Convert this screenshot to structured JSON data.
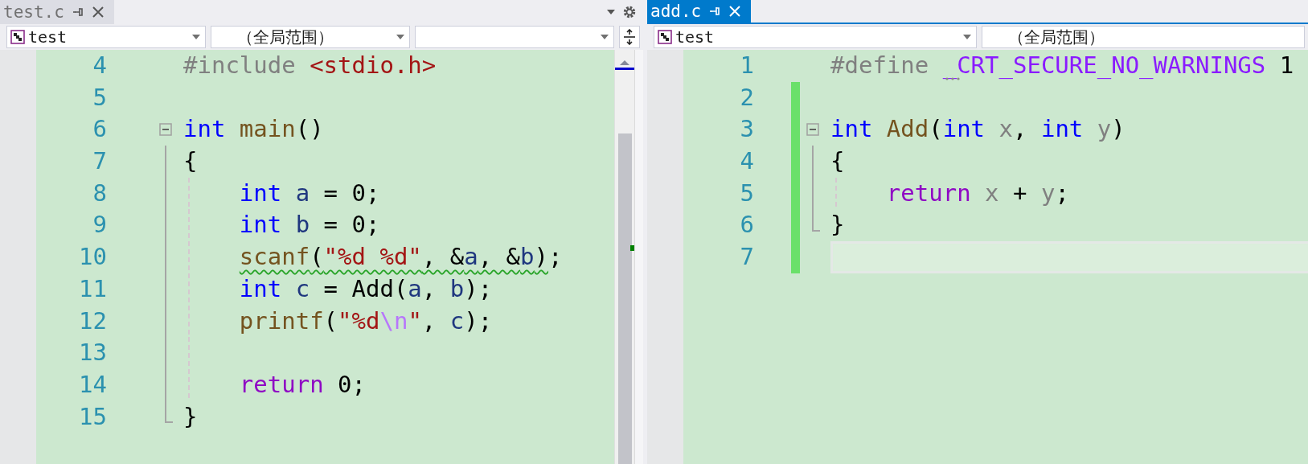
{
  "panes": [
    {
      "tab": {
        "label": "test.c",
        "selected": false
      },
      "tab_tools": true,
      "split_button": true,
      "scrollbar": true,
      "dropdowns": [
        {
          "kind": "project",
          "text": "test",
          "arrow": true
        },
        {
          "kind": "scope",
          "text": "（全局范围）",
          "arrow": true
        },
        {
          "kind": "member",
          "arrow": true
        }
      ],
      "lines": [
        {
          "number": "4",
          "tokens": [
            {
              "kind": "preprocessor",
              "text": "#include "
            },
            {
              "kind": "include",
              "text": "<stdio.h>"
            }
          ]
        },
        {
          "number": "5"
        },
        {
          "number": "6",
          "fold_start": true,
          "expanded": true,
          "tokens": [
            {
              "kind": "keyword",
              "text": "int "
            },
            {
              "kind": "func",
              "text": "main"
            },
            {
              "kind": "plain",
              "text": "()"
            }
          ]
        },
        {
          "number": "7",
          "in_fold": true,
          "tokens": [
            {
              "kind": "plain",
              "text": "{"
            }
          ]
        },
        {
          "number": "8",
          "in_fold": true,
          "indent_guide": true,
          "indented": true,
          "tokens": [
            {
              "kind": "keyword",
              "text": "int "
            },
            {
              "kind": "local",
              "text": "a"
            },
            {
              "kind": "plain",
              "text": " = 0;"
            }
          ]
        },
        {
          "number": "9",
          "in_fold": true,
          "indent_guide": true,
          "indented": true,
          "tokens": [
            {
              "kind": "keyword",
              "text": "int "
            },
            {
              "kind": "local",
              "text": "b"
            },
            {
              "kind": "plain",
              "text": " = 0;"
            }
          ]
        },
        {
          "number": "10",
          "in_fold": true,
          "indent_guide": true,
          "indented": true,
          "tokens": [
            {
              "kind": "func",
              "text": "scanf",
              "squiggle": true
            },
            {
              "kind": "plain",
              "text": "(",
              "squiggle": true
            },
            {
              "kind": "string",
              "text": "\"%d %d\"",
              "squiggle": true
            },
            {
              "kind": "plain",
              "text": ", &",
              "squiggle": true
            },
            {
              "kind": "local",
              "text": "a",
              "squiggle": true
            },
            {
              "kind": "plain",
              "text": ", &",
              "squiggle": true
            },
            {
              "kind": "local",
              "text": "b",
              "squiggle": true
            },
            {
              "kind": "plain",
              "text": ")",
              "squiggle": true
            },
            {
              "kind": "plain",
              "text": ";"
            }
          ]
        },
        {
          "number": "11",
          "in_fold": true,
          "indent_guide": true,
          "indented": true,
          "tokens": [
            {
              "kind": "keyword",
              "text": "int "
            },
            {
              "kind": "local",
              "text": "c"
            },
            {
              "kind": "plain",
              "text": " = Add("
            },
            {
              "kind": "local",
              "text": "a"
            },
            {
              "kind": "plain",
              "text": ", "
            },
            {
              "kind": "local",
              "text": "b"
            },
            {
              "kind": "plain",
              "text": ");"
            }
          ]
        },
        {
          "number": "12",
          "in_fold": true,
          "indent_guide": true,
          "indented": true,
          "tokens": [
            {
              "kind": "func",
              "text": "printf"
            },
            {
              "kind": "plain",
              "text": "("
            },
            {
              "kind": "string",
              "text": "\"%d"
            },
            {
              "kind": "escape",
              "text": "\\n"
            },
            {
              "kind": "string",
              "text": "\""
            },
            {
              "kind": "plain",
              "text": ", "
            },
            {
              "kind": "local",
              "text": "c"
            },
            {
              "kind": "plain",
              "text": ");"
            }
          ]
        },
        {
          "number": "13",
          "in_fold": true,
          "indent_guide": true
        },
        {
          "number": "14",
          "in_fold": true,
          "indent_guide": true,
          "indented": true,
          "tokens": [
            {
              "kind": "control",
              "text": "return "
            },
            {
              "kind": "plain",
              "text": "0;"
            }
          ]
        },
        {
          "number": "15",
          "fold_end": true,
          "tokens": [
            {
              "kind": "plain",
              "text": "}"
            }
          ]
        }
      ]
    },
    {
      "tab": {
        "label": "add.c",
        "selected": true
      },
      "dropdowns": [
        {
          "kind": "project",
          "text": "test",
          "arrow": true
        },
        {
          "kind": "scope",
          "text": "（全局范围）"
        }
      ],
      "lines": [
        {
          "number": "1",
          "tokens": [
            {
              "kind": "preprocessor",
              "text": "#define "
            },
            {
              "kind": "macro",
              "text": "_CRT_SECURE_NO_WARNINGS",
              "hint": true
            },
            {
              "kind": "plain",
              "text": " 1"
            }
          ]
        },
        {
          "number": "2",
          "changed": true
        },
        {
          "number": "3",
          "changed": true,
          "fold_start": true,
          "expanded": true,
          "tokens": [
            {
              "kind": "keyword",
              "text": "int "
            },
            {
              "kind": "func",
              "text": "Add"
            },
            {
              "kind": "plain",
              "text": "("
            },
            {
              "kind": "keyword",
              "text": "int "
            },
            {
              "kind": "param",
              "text": "x"
            },
            {
              "kind": "plain",
              "text": ", "
            },
            {
              "kind": "keyword",
              "text": "int "
            },
            {
              "kind": "param",
              "text": "y"
            },
            {
              "kind": "plain",
              "text": ")"
            }
          ]
        },
        {
          "number": "4",
          "changed": true,
          "in_fold": true,
          "tokens": [
            {
              "kind": "plain",
              "text": "{"
            }
          ]
        },
        {
          "number": "5",
          "changed": true,
          "in_fold": true,
          "indent_guide": true,
          "indented": true,
          "tokens": [
            {
              "kind": "control",
              "text": "return "
            },
            {
              "kind": "param",
              "text": "x"
            },
            {
              "kind": "plain",
              "text": " + "
            },
            {
              "kind": "param",
              "text": "y"
            },
            {
              "kind": "plain",
              "text": ";"
            }
          ]
        },
        {
          "number": "6",
          "changed": true,
          "fold_end": true,
          "tokens": [
            {
              "kind": "plain",
              "text": "}"
            }
          ]
        },
        {
          "number": "7",
          "changed": true,
          "current": true
        }
      ]
    }
  ]
}
